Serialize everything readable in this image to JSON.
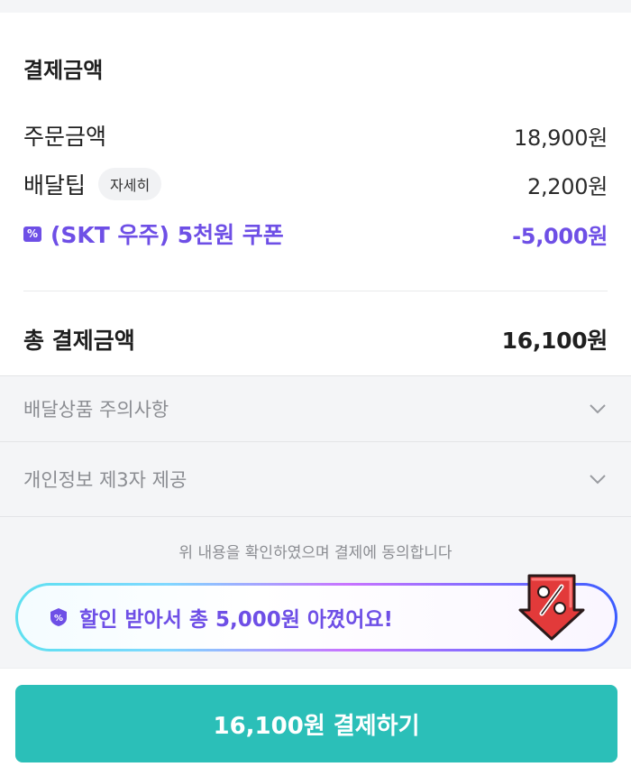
{
  "payment": {
    "section_title": "결제금액",
    "order_amount_label": "주문금액",
    "order_amount": "18,900원",
    "delivery_tip_label": "배달팁",
    "delivery_tip_detail": "자세히",
    "delivery_tip": "2,200원",
    "coupon_label": "(SKT 우주) 5천원 쿠폰",
    "coupon_amount": "-5,000원",
    "total_label": "총 결제금액",
    "total_amount": "16,100원"
  },
  "accordions": [
    {
      "label": "배달상품 주의사항"
    },
    {
      "label": "개인정보 제3자 제공"
    }
  ],
  "agreement_text": "위 내용을 확인하였으며 결제에 동의합니다",
  "savings_banner": {
    "text": "할인 받아서 총 5,000원 아꼈어요!"
  },
  "pay_button_label": "16,100원 결제하기",
  "colors": {
    "accent_purple": "#6e4fe6",
    "pay_button": "#2bbfb8"
  },
  "icons": {
    "coupon": "coupon-percent-icon",
    "chevron": "chevron-down-icon",
    "banner_badge": "discount-badge-icon",
    "banner_illustration": "discount-tag-arrow-icon"
  }
}
